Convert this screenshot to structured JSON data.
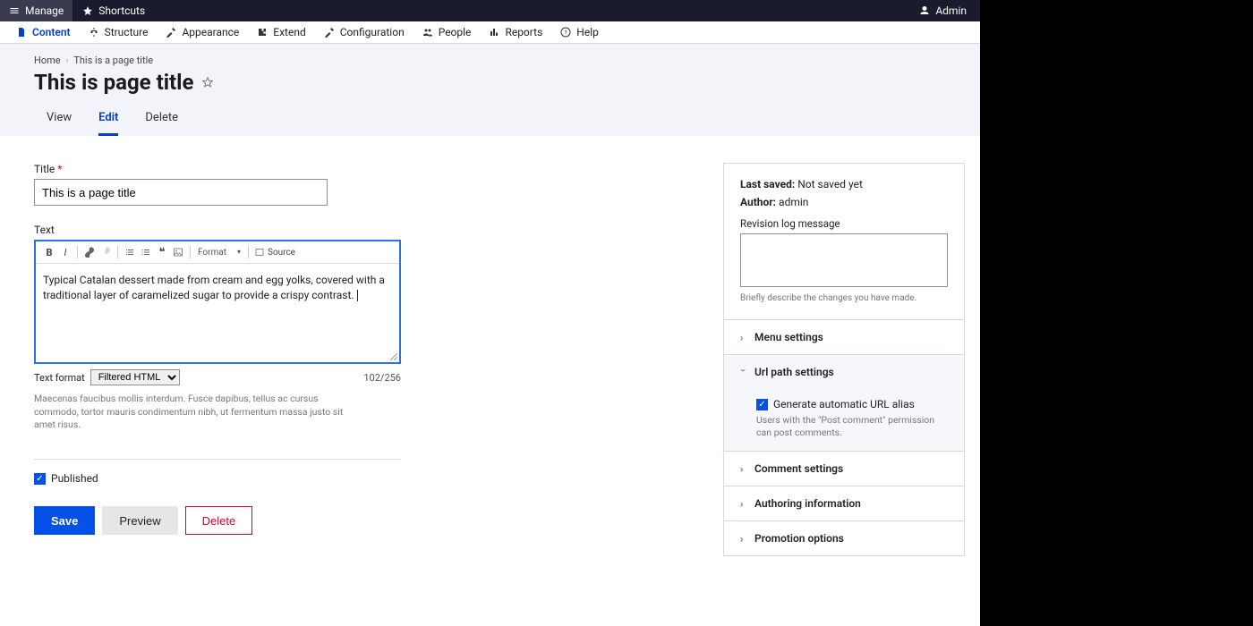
{
  "topbar": {
    "manage": "Manage",
    "shortcuts": "Shortcuts",
    "admin": "Admin"
  },
  "menubar": {
    "items": [
      {
        "label": "Content",
        "active": true
      },
      {
        "label": "Structure"
      },
      {
        "label": "Appearance"
      },
      {
        "label": "Extend"
      },
      {
        "label": "Configuration"
      },
      {
        "label": "People"
      },
      {
        "label": "Reports"
      },
      {
        "label": "Help"
      }
    ]
  },
  "breadcrumb": {
    "home": "Home",
    "current": "This is a page title"
  },
  "page_title": "This is page title",
  "tabs": {
    "view": "View",
    "edit": "Edit",
    "delete": "Delete"
  },
  "form": {
    "title_label": "Title",
    "title_value": "This is a page title",
    "text_label": "Text",
    "body": "Typical Catalan dessert made from cream and egg yolks, covered with a traditional layer of caramelized sugar to provide a crispy contrast.",
    "format_label": "Format",
    "source_label": "Source",
    "text_format_label": "Text format",
    "text_format_value": "Filtered HTML",
    "counter": "102/256",
    "hint": "Maecenas faucibus mollis interdum. Fusce dapibus, tellus ac cursus commodo, tortor mauris condimentum nibh, ut fermentum massa justo sit amet risus.",
    "published": "Published",
    "save": "Save",
    "preview": "Preview",
    "delete": "Delete"
  },
  "sidebar": {
    "last_saved_label": "Last saved:",
    "last_saved_value": "Not saved yet",
    "author_label": "Author:",
    "author_value": "admin",
    "revlog_label": "Revision log message",
    "revlog_hint": "Briefly describe the changes you have made.",
    "menu_settings": "Menu settings",
    "url_path": "Url path settings",
    "gen_alias": "Generate automatic URL alias",
    "gen_hint": "Users with the  \"Post comment\" permission can post comments.",
    "comment_settings": "Comment settings",
    "authoring": "Authoring information",
    "promotion": "Promotion options"
  }
}
